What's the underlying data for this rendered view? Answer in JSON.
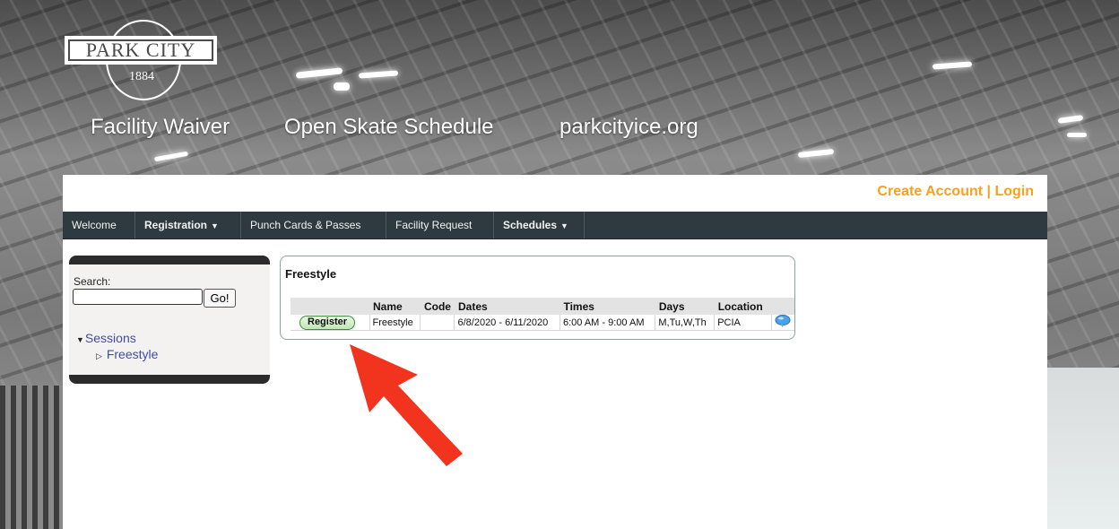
{
  "logo": {
    "name": "PARK CITY",
    "year": "1884"
  },
  "top_links": [
    "Facility Waiver",
    "Open Skate Schedule",
    "parkcityice.org"
  ],
  "account": {
    "create": "Create Account",
    "separator": " | ",
    "login": "Login"
  },
  "nav": {
    "items": [
      {
        "label": "Welcome",
        "bold": false,
        "dropdown": false
      },
      {
        "label": "Registration",
        "bold": true,
        "dropdown": true
      },
      {
        "label": "Punch Cards & Passes",
        "bold": false,
        "dropdown": false
      },
      {
        "label": "Facility Request",
        "bold": false,
        "dropdown": false
      },
      {
        "label": "Schedules",
        "bold": true,
        "dropdown": true
      }
    ],
    "dropdown_glyph": "▼"
  },
  "sidebar": {
    "search_label": "Search:",
    "search_value": "",
    "go_label": "Go!",
    "tree": {
      "root": "Sessions",
      "child": "Freestyle"
    }
  },
  "freestyle": {
    "title": "Freestyle",
    "columns": [
      "",
      "Name",
      "Code",
      "Dates",
      "Times",
      "Days",
      "Location",
      ""
    ],
    "row": {
      "button": "Register",
      "name": "Freestyle",
      "code": "",
      "dates": "6/8/2020 - 6/11/2020",
      "times": "6:00 AM - 9:00 AM",
      "days": "M,Tu,W,Th",
      "location": "PCIA",
      "info_icon": "info-icon"
    }
  },
  "colors": {
    "accent_orange": "#f7a11e",
    "nav_bg": "#2f3a40",
    "link_blue": "#3e4ea8",
    "annotation_red": "#f2331e"
  }
}
